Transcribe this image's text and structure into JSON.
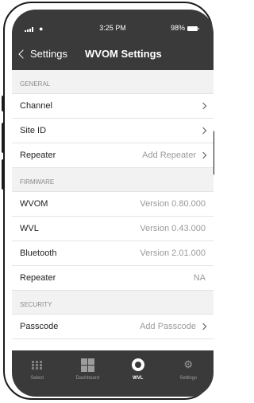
{
  "status": {
    "time": "3:25 PM",
    "battery": "98%"
  },
  "nav": {
    "back_label": "Settings",
    "title": "WVOM Settings"
  },
  "sections": [
    {
      "header": "GENERAL",
      "rows": [
        {
          "label": "Channel",
          "value": ""
        },
        {
          "label": "Site ID",
          "value": ""
        },
        {
          "label": "Repeater",
          "value": "Add Repeater"
        }
      ]
    },
    {
      "header": "FIRMWARE",
      "rows": [
        {
          "label": "WVOM",
          "value": "Version 0.80.000"
        },
        {
          "label": "WVL",
          "value": "Version 0.43.000"
        },
        {
          "label": "Bluetooth",
          "value": "Version 2.01.000"
        },
        {
          "label": "Repeater",
          "value": "NA"
        }
      ]
    },
    {
      "header": "SECURITY",
      "rows": [
        {
          "label": "Passcode",
          "value": "Add Passcode"
        }
      ]
    }
  ],
  "tabs": [
    {
      "label": "Select",
      "icon": "dot-grid-icon"
    },
    {
      "label": "Dashboard",
      "icon": "dashboard-icon"
    },
    {
      "label": "WVL",
      "icon": "wvl-icon",
      "active": true
    },
    {
      "label": "Settings",
      "icon": "gear-icon"
    }
  ],
  "colors": {
    "bar": "#3a3a3a",
    "section_bg": "#f2f2f2"
  }
}
